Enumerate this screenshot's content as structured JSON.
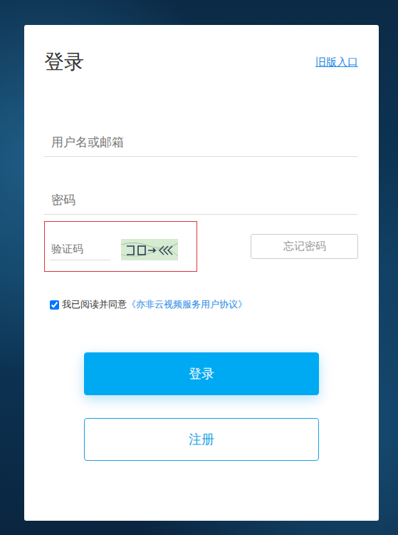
{
  "title": "登录",
  "old_entry": "旧版入口",
  "fields": [
    {
      "placeholder": "用户名或邮箱",
      "kind": "text"
    },
    {
      "placeholder": "密码",
      "kind": "password"
    }
  ],
  "captcha": {
    "placeholder": "验证码",
    "highlighted": true
  },
  "forgot_button": "忘记密码",
  "agreement": {
    "checked": true,
    "text": "我已阅读并同意",
    "link": "《亦非云视频服务用户协议》"
  },
  "buttons": [
    {
      "label": "登录",
      "kind": "primary"
    },
    {
      "label": "注册",
      "kind": "outline"
    }
  ]
}
